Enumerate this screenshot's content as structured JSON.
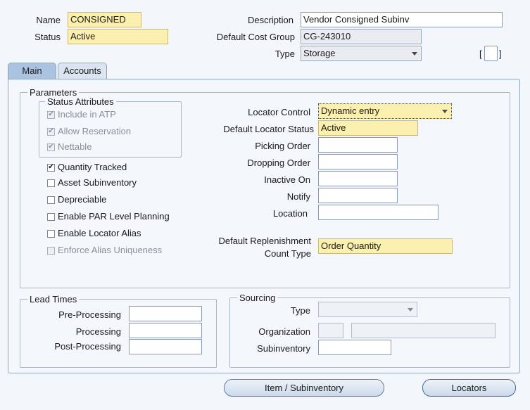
{
  "header": {
    "name_label": "Name",
    "name_value": "CONSIGNED",
    "status_label": "Status",
    "status_value": "Active",
    "description_label": "Description",
    "description_value": "Vendor Consigned Subinv",
    "cost_group_label": "Default Cost Group",
    "cost_group_value": "CG-243010",
    "type_label": "Type",
    "type_value": "Storage",
    "flex_open": "[",
    "flex_close": "]"
  },
  "tabs": [
    {
      "label": "Main",
      "active": true
    },
    {
      "label": "Accounts",
      "active": false
    }
  ],
  "parameters": {
    "title": "Parameters",
    "status_attributes": {
      "title": "Status Attributes",
      "items": [
        {
          "label": "Include in ATP",
          "checked": true,
          "enabled": false
        },
        {
          "label": "Allow Reservation",
          "checked": true,
          "enabled": false
        },
        {
          "label": "Nettable",
          "checked": true,
          "enabled": false
        }
      ]
    },
    "checkboxes": [
      {
        "label": "Quantity Tracked",
        "checked": true,
        "enabled": true
      },
      {
        "label": "Asset Subinventory",
        "checked": false,
        "enabled": true
      },
      {
        "label": "Depreciable",
        "checked": false,
        "enabled": true
      },
      {
        "label": "Enable PAR Level Planning",
        "checked": false,
        "enabled": true
      },
      {
        "label": "Enable Locator Alias",
        "checked": false,
        "enabled": true
      },
      {
        "label": "Enforce Alias Uniqueness",
        "checked": false,
        "enabled": false
      }
    ],
    "locator_control_label": "Locator Control",
    "locator_control_value": "Dynamic entry",
    "default_locator_status_label": "Default Locator Status",
    "default_locator_status_value": "Active",
    "picking_order_label": "Picking Order",
    "picking_order_value": "",
    "dropping_order_label": "Dropping Order",
    "dropping_order_value": "",
    "inactive_on_label": "Inactive On",
    "inactive_on_value": "",
    "notify_label": "Notify",
    "notify_value": "",
    "location_label": "Location",
    "location_value": "",
    "replenishment_label_line1": "Default Replenishment",
    "replenishment_label_line2": "Count Type",
    "replenishment_value": "Order Quantity"
  },
  "lead_times": {
    "title": "Lead Times",
    "pre_processing_label": "Pre-Processing",
    "pre_processing_value": "",
    "processing_label": "Processing",
    "processing_value": "",
    "post_processing_label": "Post-Processing",
    "post_processing_value": ""
  },
  "sourcing": {
    "title": "Sourcing",
    "type_label": "Type",
    "type_value": "",
    "organization_label": "Organization",
    "organization_code": "",
    "organization_name": "",
    "subinventory_label": "Subinventory",
    "subinventory_value": ""
  },
  "buttons": {
    "item_subinventory": "Item / Subinventory",
    "locators": "Locators"
  }
}
